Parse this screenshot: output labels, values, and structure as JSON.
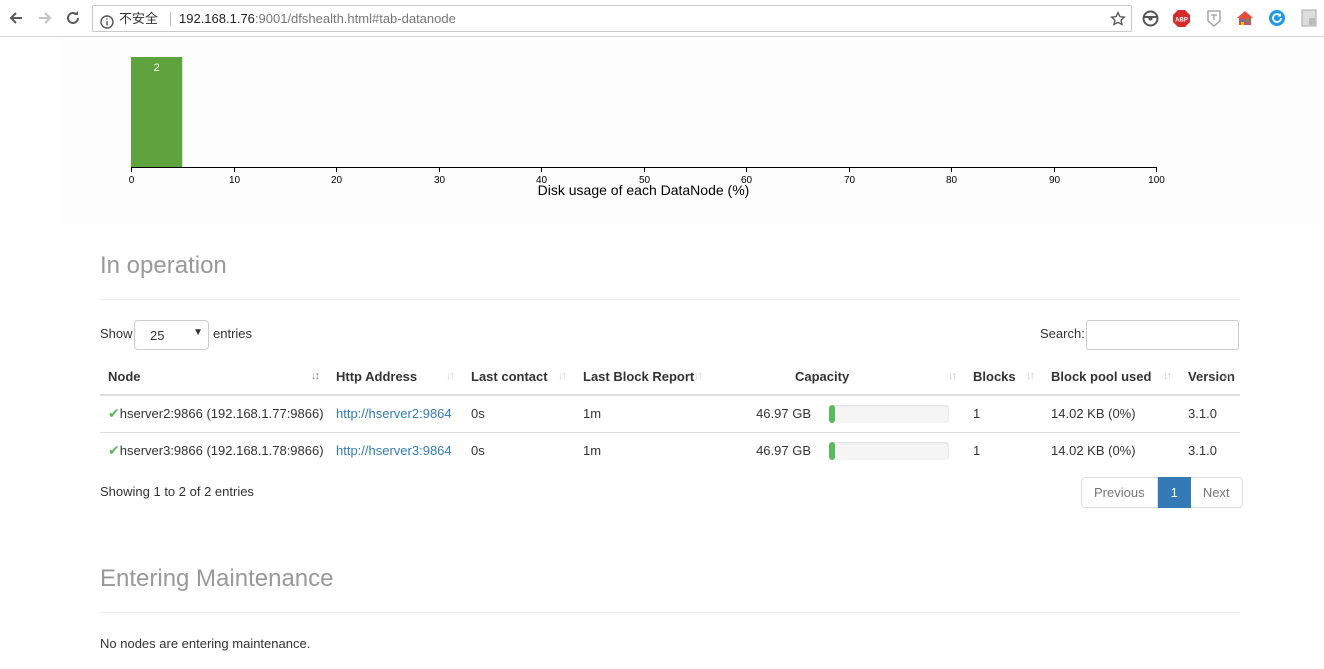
{
  "browser": {
    "insecure_label": "不安全",
    "url_host": "192.168.1.76",
    "url_rest": ":9001/dfshealth.html#tab-datanode",
    "extensions": [
      "steering-wheel-icon",
      "adblock-icon",
      "translate-icon",
      "home-colored-icon",
      "refresh-blue-icon",
      "grid-icon"
    ]
  },
  "chart_data": {
    "type": "bar",
    "bins": [
      {
        "from": 0,
        "to": 5,
        "count": 2
      }
    ],
    "values": [
      2
    ],
    "xlabel": "Disk usage of each DataNode (%)",
    "xlim": [
      0,
      100
    ],
    "x_ticks": [
      "0",
      "10",
      "20",
      "30",
      "40",
      "50",
      "60",
      "70",
      "80",
      "90",
      "100"
    ],
    "bar_color": "#5fa33f"
  },
  "in_operation": {
    "title": "In operation",
    "show_label": "Show",
    "page_length": "25",
    "entries_label": "entries",
    "search_label": "Search:",
    "columns": [
      "Node",
      "Http Address",
      "Last contact",
      "Last Block Report",
      "Capacity",
      "Blocks",
      "Block pool used",
      "Version"
    ],
    "rows": [
      {
        "node": "hserver2:9866 (192.168.1.77:9866)",
        "http": "http://hserver2:9864",
        "last_contact": "0s",
        "last_block_report": "1m",
        "capacity": "46.97 GB",
        "capacity_used_pct": 5,
        "blocks": "1",
        "block_pool_used": "14.02 KB (0%)",
        "version": "3.1.0"
      },
      {
        "node": "hserver3:9866 (192.168.1.78:9866)",
        "http": "http://hserver3:9864",
        "last_contact": "0s",
        "last_block_report": "1m",
        "capacity": "46.97 GB",
        "capacity_used_pct": 5,
        "blocks": "1",
        "block_pool_used": "14.02 KB (0%)",
        "version": "3.1.0"
      }
    ],
    "info": "Showing 1 to 2 of 2 entries",
    "pager": {
      "previous": "Previous",
      "current": "1",
      "next": "Next"
    }
  },
  "maintenance": {
    "title": "Entering Maintenance",
    "message": "No nodes are entering maintenance."
  }
}
